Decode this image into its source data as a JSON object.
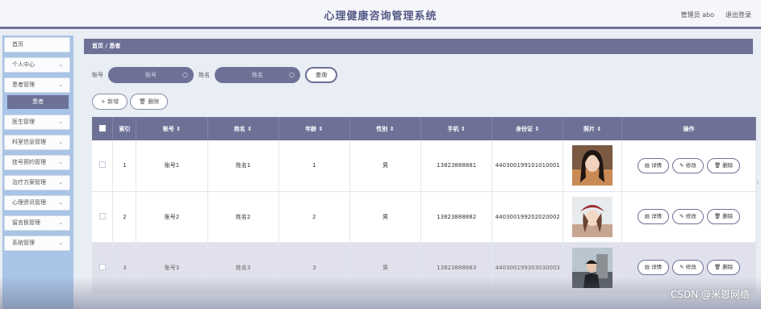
{
  "header": {
    "title": "心理健康咨询管理系统",
    "user_label": "管理员 abo",
    "logout_label": "退出登录"
  },
  "sidebar": {
    "items": [
      {
        "label": "首页"
      },
      {
        "label": "个人中心"
      },
      {
        "label": "患者管理"
      },
      {
        "label": "医生管理"
      },
      {
        "label": "科室信息管理"
      },
      {
        "label": "挂号预约管理"
      },
      {
        "label": "治疗方案管理"
      },
      {
        "label": "心理资讯管理"
      },
      {
        "label": "留言板管理"
      },
      {
        "label": "系统管理"
      }
    ],
    "active_sub": "患者"
  },
  "breadcrumb": "首页 / 患者",
  "search": {
    "account_label": "账号",
    "account_placeholder": "账号",
    "name_label": "姓名",
    "name_placeholder": "姓名",
    "query_button": "查询"
  },
  "actions": {
    "add_label": "+ 新增",
    "delete_label": "删除"
  },
  "table": {
    "headers": [
      "索引",
      "账号 ⇕",
      "姓名 ⇕",
      "年龄 ⇕",
      "性别 ⇕",
      "手机 ⇕",
      "身份证 ⇕",
      "照片 ⇕",
      "操作"
    ],
    "rows": [
      {
        "index": "1",
        "account": "账号1",
        "name": "姓名1",
        "age": "1",
        "gender": "男",
        "phone": "13823888881",
        "id_card": "440300199101010001"
      },
      {
        "index": "2",
        "account": "账号2",
        "name": "姓名2",
        "age": "2",
        "gender": "男",
        "phone": "13823888882",
        "id_card": "440300199202020002"
      },
      {
        "index": "3",
        "account": "账号3",
        "name": "姓名3",
        "age": "3",
        "gender": "男",
        "phone": "13823888883",
        "id_card": "440300199303030003"
      }
    ],
    "op_detail": "详情",
    "op_edit": "修改",
    "op_delete": "删除"
  },
  "watermark": "CSDN @米恩网络",
  "colors": {
    "accent": "#6d7196",
    "sidebar_bg": "#a8c4e6"
  }
}
